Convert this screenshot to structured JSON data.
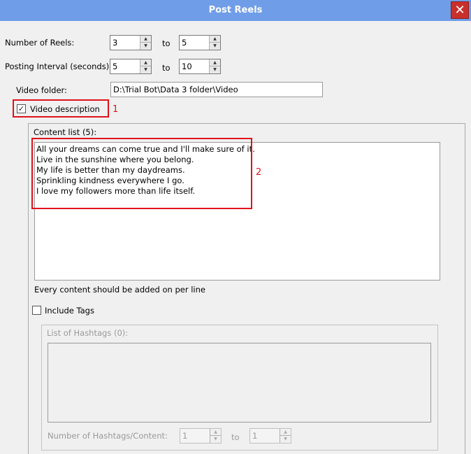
{
  "window": {
    "title": "Post Reels",
    "close_icon": "✕"
  },
  "reels": {
    "label": "Number of Reels:",
    "from": "3",
    "to_label": "to",
    "to": "5"
  },
  "interval": {
    "label": "Posting Interval (seconds):",
    "from": "5",
    "to_label": "to",
    "to": "10"
  },
  "video_folder": {
    "label": "Video folder:",
    "value": "D:\\Trial Bot\\Data 3 folder\\Video"
  },
  "video_description": {
    "label": "Video description",
    "checked": true,
    "check_mark": "✓"
  },
  "content": {
    "group_label": "Content list (5):",
    "lines": [
      "All your dreams can come true and I'll make sure of it.",
      "Live in the sunshine where you belong.",
      "My life is better than my daydreams.",
      "Sprinkling kindness everywhere I go.",
      "I love my followers more than life itself."
    ],
    "hint": "Every content should be added on per line"
  },
  "include_tags": {
    "label": "Include Tags",
    "checked": false
  },
  "hashtags": {
    "group_label": "List of Hashtags (0):",
    "count_label": "Number of Hashtags/Content:",
    "from": "1",
    "to_label": "to",
    "to": "1"
  },
  "annotations": {
    "one": "1",
    "two": "2",
    "color": "#e0121b"
  },
  "spin_arrows": {
    "up": "▲",
    "down": "▼"
  }
}
